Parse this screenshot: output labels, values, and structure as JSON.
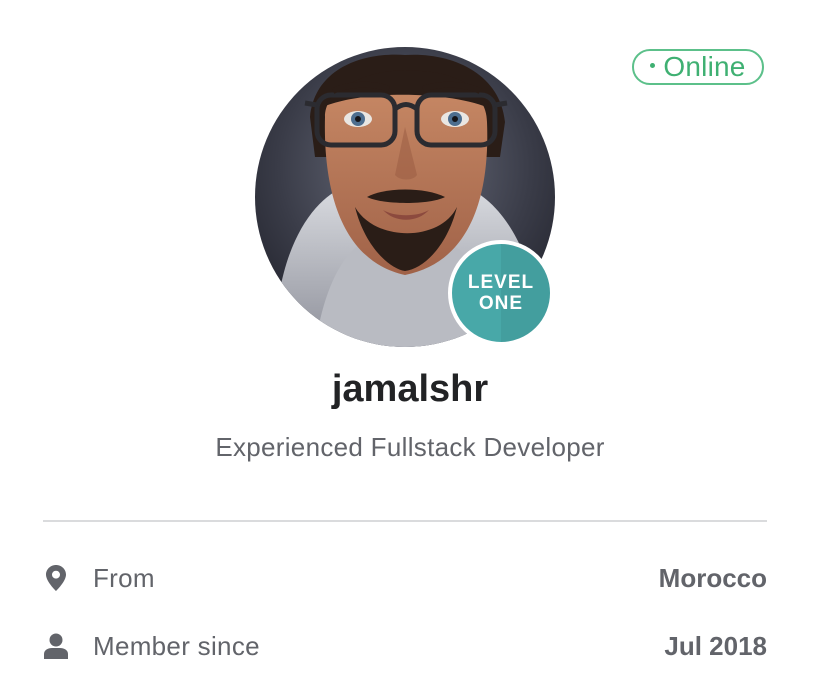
{
  "status": {
    "label": "Online",
    "color": "#3fb072"
  },
  "avatar": {
    "alt": "Profile photo"
  },
  "level_badge": {
    "line1": "LEVEL",
    "line2": "ONE",
    "color": "#48a8a8"
  },
  "profile": {
    "username": "jamalshr",
    "tagline": "Experienced Fullstack Developer"
  },
  "details": {
    "from": {
      "icon": "location-pin-icon",
      "label": "From",
      "value": "Morocco"
    },
    "member_since": {
      "icon": "user-icon",
      "label": "Member since",
      "value": "Jul 2018"
    }
  }
}
